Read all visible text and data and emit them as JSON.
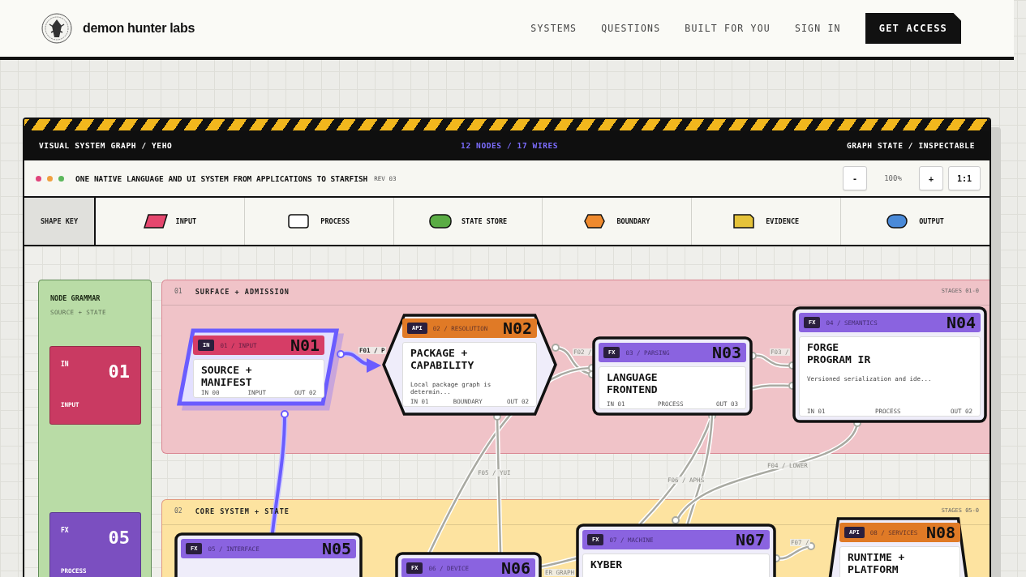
{
  "brand": {
    "name": "demon hunter labs"
  },
  "nav": [
    {
      "label": "SYSTEMS"
    },
    {
      "label": "QUESTIONS"
    },
    {
      "label": "BUILT FOR YOU"
    },
    {
      "label": "SIGN IN"
    }
  ],
  "cta": "GET ACCESS",
  "panel": {
    "title": "VISUAL SYSTEM GRAPH / YEHO",
    "counts": "12 NODES / 17 WIRES",
    "state": "GRAPH STATE / INSPECTABLE"
  },
  "toolbar": {
    "dots": [
      {
        "color": "#e0457b"
      },
      {
        "color": "#f0a040"
      },
      {
        "color": "#5cb85c"
      }
    ],
    "heading": "ONE NATIVE LANGUAGE AND UI SYSTEM FROM APPLICATIONS TO STARFISH",
    "rev": "REV 03",
    "zoom_out": "-",
    "zoom": "100%",
    "zoom_in": "+",
    "reset": "1:1"
  },
  "shape_key": {
    "label": "SHAPE KEY",
    "items": [
      {
        "kind": "input",
        "label": "INPUT",
        "color": "#e5476e"
      },
      {
        "kind": "process",
        "label": "PROCESS",
        "color": "#ffffff"
      },
      {
        "kind": "state",
        "label": "STATE STORE",
        "color": "#5aac44"
      },
      {
        "kind": "boundary",
        "label": "BOUNDARY",
        "color": "#ef8a2e"
      },
      {
        "kind": "evidence",
        "label": "EVIDENCE",
        "color": "#e5c33a"
      },
      {
        "kind": "output",
        "label": "OUTPUT",
        "color": "#4a8ad8"
      }
    ]
  },
  "grammar": {
    "title": "NODE GRAMMAR",
    "subtitle": "SOURCE + STATE",
    "cards": [
      {
        "tag": "IN",
        "number": "01",
        "role": "INPUT",
        "color": "#c93a62"
      },
      {
        "tag": "FX",
        "number": "05",
        "role": "PROCESS",
        "color": "#7b4fc0"
      }
    ]
  },
  "stages": [
    {
      "index": "01",
      "title": "SURFACE + ADMISSION",
      "range": "STAGES 01-0",
      "color": "#f0c3c8"
    },
    {
      "index": "02",
      "title": "CORE SYSTEM + STATE",
      "range": "STAGES 05-0",
      "color": "#fde3a0"
    }
  ],
  "wires": [
    {
      "kind": "active",
      "label": "F01 / P"
    },
    {
      "kind": "active"
    },
    {
      "kind": "idle",
      "label": "F02 /"
    },
    {
      "kind": "idle"
    },
    {
      "kind": "idle",
      "label": "F05 / YUI"
    },
    {
      "kind": "idle",
      "label": "F03 /"
    },
    {
      "kind": "idle"
    },
    {
      "kind": "idle",
      "label": "F06 / APHS"
    },
    {
      "kind": "idle"
    },
    {
      "kind": "idle",
      "label": "F04 / LOWER"
    },
    {
      "kind": "idle",
      "label": "ER GRAPH"
    },
    {
      "kind": "idle",
      "label": "F07 /"
    }
  ],
  "nodes": [
    {
      "id": "N01",
      "tag": "IN",
      "subtitle": "01 / INPUT",
      "kind": "input",
      "title": "SOURCE +\nMANIFEST",
      "ports": [
        "IN 00",
        "INPUT",
        "OUT 02"
      ],
      "selected": true
    },
    {
      "id": "N02",
      "tag": "API",
      "subtitle": "02 / RESOLUTION",
      "kind": "boundary",
      "title": "PACKAGE +\nCAPABILITY",
      "desc": "Local package graph is determin...",
      "ports": [
        "IN 01",
        "BOUNDARY",
        "OUT 02"
      ],
      "selected": false
    },
    {
      "id": "N03",
      "tag": "FX",
      "subtitle": "03 / PARSING",
      "kind": "process",
      "title": "LANGUAGE\nFRONTEND",
      "ports": [
        "IN 01",
        "PROCESS",
        "OUT 03"
      ],
      "selected": false
    },
    {
      "id": "N04",
      "tag": "FX",
      "subtitle": "04 / SEMANTICS",
      "kind": "process",
      "title": "FORGE\nPROGRAM IR",
      "desc": "Versioned serialization and ide...",
      "ports": [
        "IN 01",
        "PROCESS",
        "OUT 02"
      ],
      "selected": false
    },
    {
      "id": "N05",
      "tag": "FX",
      "subtitle": "05 / INTERFACE",
      "kind": "process",
      "selected": false
    },
    {
      "id": "N06",
      "tag": "FX",
      "subtitle": "06 / DEVICE",
      "kind": "process",
      "selected": false
    },
    {
      "id": "N07",
      "tag": "FX",
      "subtitle": "07 / MACHINE",
      "kind": "process",
      "title": "KYBER",
      "selected": false
    },
    {
      "id": "N08",
      "tag": "API",
      "subtitle": "08 / SERVICES",
      "kind": "output",
      "title": "RUNTIME +\nPLATFORM",
      "selected": false
    }
  ]
}
